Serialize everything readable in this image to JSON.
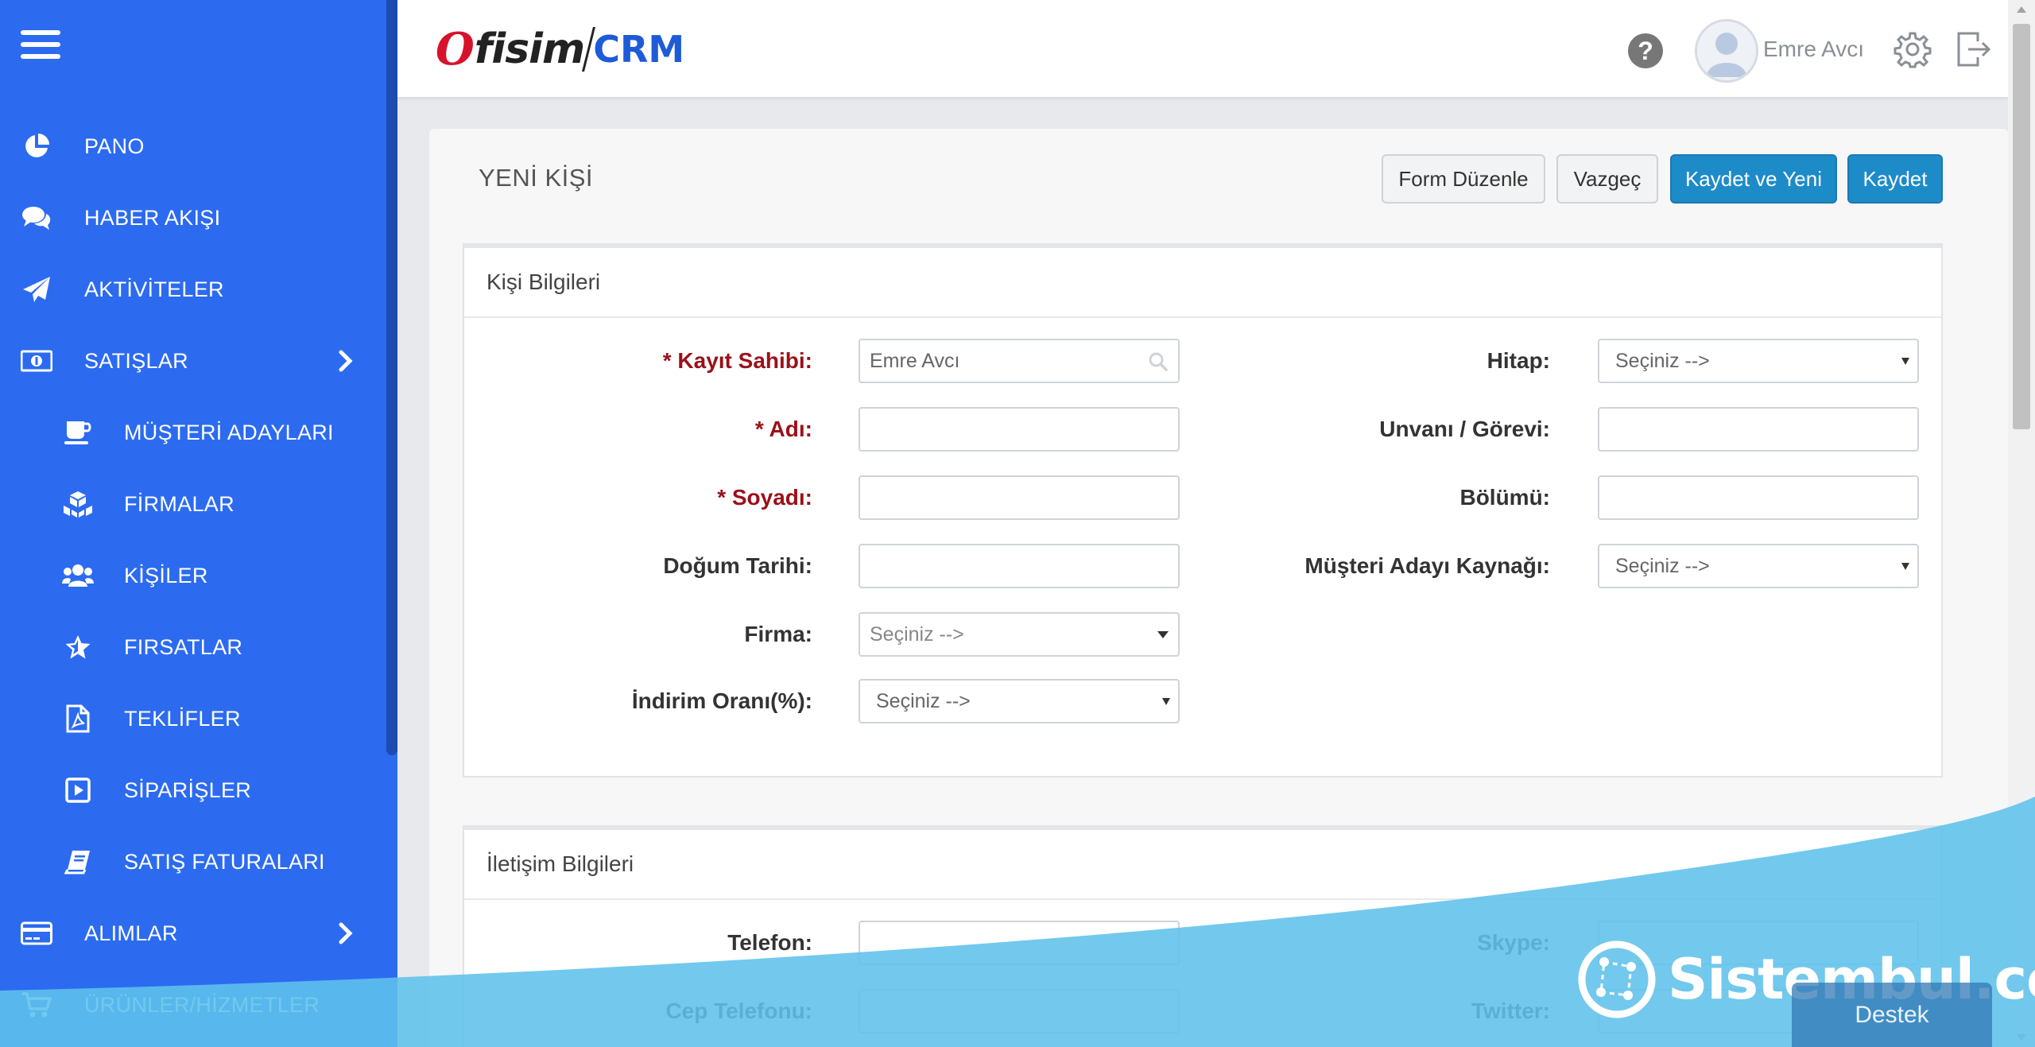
{
  "sidebar": {
    "items": [
      {
        "label": "PANO",
        "icon": "pie-chart-icon"
      },
      {
        "label": "HABER AKIŞI",
        "icon": "comments-icon"
      },
      {
        "label": "AKTİVİTELER",
        "icon": "paper-plane-icon"
      },
      {
        "label": "SATIŞLAR",
        "icon": "money-icon",
        "expandable": true
      },
      {
        "label": "MÜŞTERİ ADAYLARI",
        "icon": "coffee-cup-icon"
      },
      {
        "label": "FİRMALAR",
        "icon": "cubes-icon"
      },
      {
        "label": "KİŞİLER",
        "icon": "users-icon"
      },
      {
        "label": "FIRSATLAR",
        "icon": "star-icon"
      },
      {
        "label": "TEKLİFLER",
        "icon": "pdf-file-icon"
      },
      {
        "label": "SİPARİŞLER",
        "icon": "play-square-icon"
      },
      {
        "label": "SATIŞ FATURALARI",
        "icon": "book-icon"
      },
      {
        "label": "ALIMLAR",
        "icon": "credit-card-icon",
        "expandable": true
      },
      {
        "label": "ÜRÜNLER/HİZMETLER",
        "icon": "shopping-cart-icon"
      }
    ]
  },
  "header": {
    "logo": {
      "o": "O",
      "fisim": "fisim",
      "crm": "CRM"
    },
    "user_name": "Emre Avcı"
  },
  "main": {
    "title": "YENİ KİŞİ",
    "buttons": {
      "form_edit": "Form Düzenle",
      "cancel": "Vazgeç",
      "save_new": "Kaydet ve Yeni",
      "save": "Kaydet"
    },
    "person_panel": {
      "title": "Kişi Bilgileri",
      "owner_label": "* Kayıt Sahibi:",
      "owner_value": "Emre Avcı",
      "first_name_label": "* Adı:",
      "last_name_label": "* Soyadı:",
      "birth_date_label": "Doğum Tarihi:",
      "company_label": "Firma:",
      "company_value": "Seçiniz -->",
      "discount_label": "İndirim Oranı(%):",
      "discount_value": "Seçiniz -->",
      "salutation_label": "Hitap:",
      "salutation_value": "Seçiniz -->",
      "title_label": "Unvanı / Görevi:",
      "department_label": "Bölümü:",
      "lead_source_label": "Müşteri Adayı Kaynağı:",
      "lead_source_value": "Seçiniz -->"
    },
    "contact_panel": {
      "title": "İletişim Bilgileri",
      "phone_label": "Telefon:",
      "mobile_label": "Cep Telefonu:",
      "skype_label": "Skype:",
      "twitter_label": "Twitter:"
    }
  },
  "overlay": {
    "watermark": "Sistembul.com",
    "support": "Destek"
  },
  "colors": {
    "sidebar": "#2c6bf0",
    "primary_button": "#1e8bc9",
    "required_label": "#9b1019",
    "wave": "#5ec2ea"
  }
}
